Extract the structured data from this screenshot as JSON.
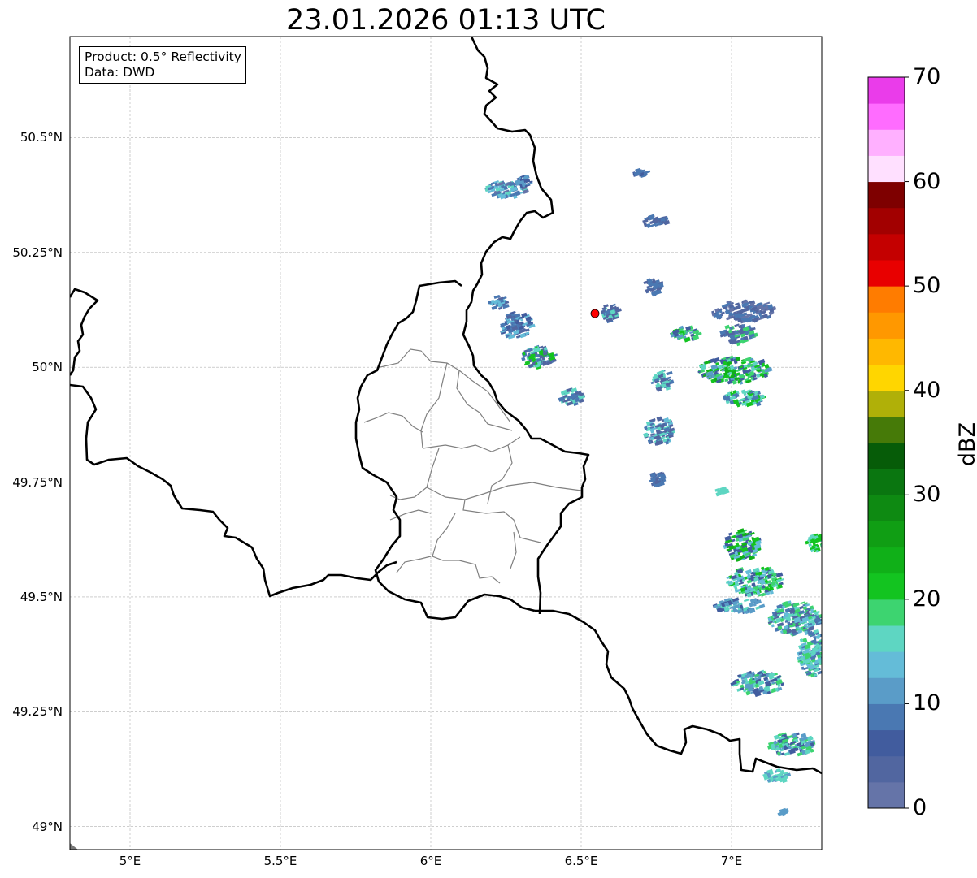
{
  "title": "23.01.2026 01:13 UTC",
  "info": {
    "product": "Product: 0.5° Reflectivity",
    "source": "Data: DWD"
  },
  "map": {
    "lon_range": [
      4.8,
      7.3
    ],
    "lat_range": [
      48.95,
      50.72
    ],
    "lat_ticks": [
      {
        "value": 50.5,
        "label": "50.5°N"
      },
      {
        "value": 50.25,
        "label": "50.25°N"
      },
      {
        "value": 50.0,
        "label": "50°N"
      },
      {
        "value": 49.75,
        "label": "49.75°N"
      },
      {
        "value": 49.5,
        "label": "49.5°N"
      },
      {
        "value": 49.25,
        "label": "49.25°N"
      },
      {
        "value": 49.0,
        "label": "49°N"
      }
    ],
    "lon_ticks": [
      {
        "value": 5.0,
        "label": "5°E"
      },
      {
        "value": 5.5,
        "label": "5.5°E"
      },
      {
        "value": 6.0,
        "label": "6°E"
      },
      {
        "value": 6.5,
        "label": "6.5°E"
      },
      {
        "value": 7.0,
        "label": "7°E"
      }
    ],
    "radar_site_color": "#ff0000",
    "border_color": "#000000",
    "admin_border_color": "#808080",
    "grid_color": "#b0b0b0"
  },
  "colorbar": {
    "label": "dBZ",
    "min": 0,
    "max": 70,
    "tick_labels": [
      {
        "value": 0,
        "label": "0"
      },
      {
        "value": 10,
        "label": "10"
      },
      {
        "value": 20,
        "label": "20"
      },
      {
        "value": 30,
        "label": "30"
      },
      {
        "value": 40,
        "label": "40"
      },
      {
        "value": 50,
        "label": "50"
      },
      {
        "value": 60,
        "label": "60"
      },
      {
        "value": 70,
        "label": "70"
      }
    ],
    "colors": [
      "#6574a8",
      "#5166a0",
      "#415c9e",
      "#4a78b2",
      "#5a9cc8",
      "#64bcd8",
      "#5ed6c2",
      "#3dd470",
      "#13c420",
      "#10b018",
      "#109e14",
      "#0e8a12",
      "#0a7610",
      "#065c08",
      "#467a08",
      "#b0b008",
      "#ffd600",
      "#ffb800",
      "#ff9800",
      "#ff7c00",
      "#e80000",
      "#c40000",
      "#a20000",
      "#7e0000",
      "#ffe0ff",
      "#ffb0ff",
      "#ff6cff",
      "#ea3cea"
    ]
  }
}
